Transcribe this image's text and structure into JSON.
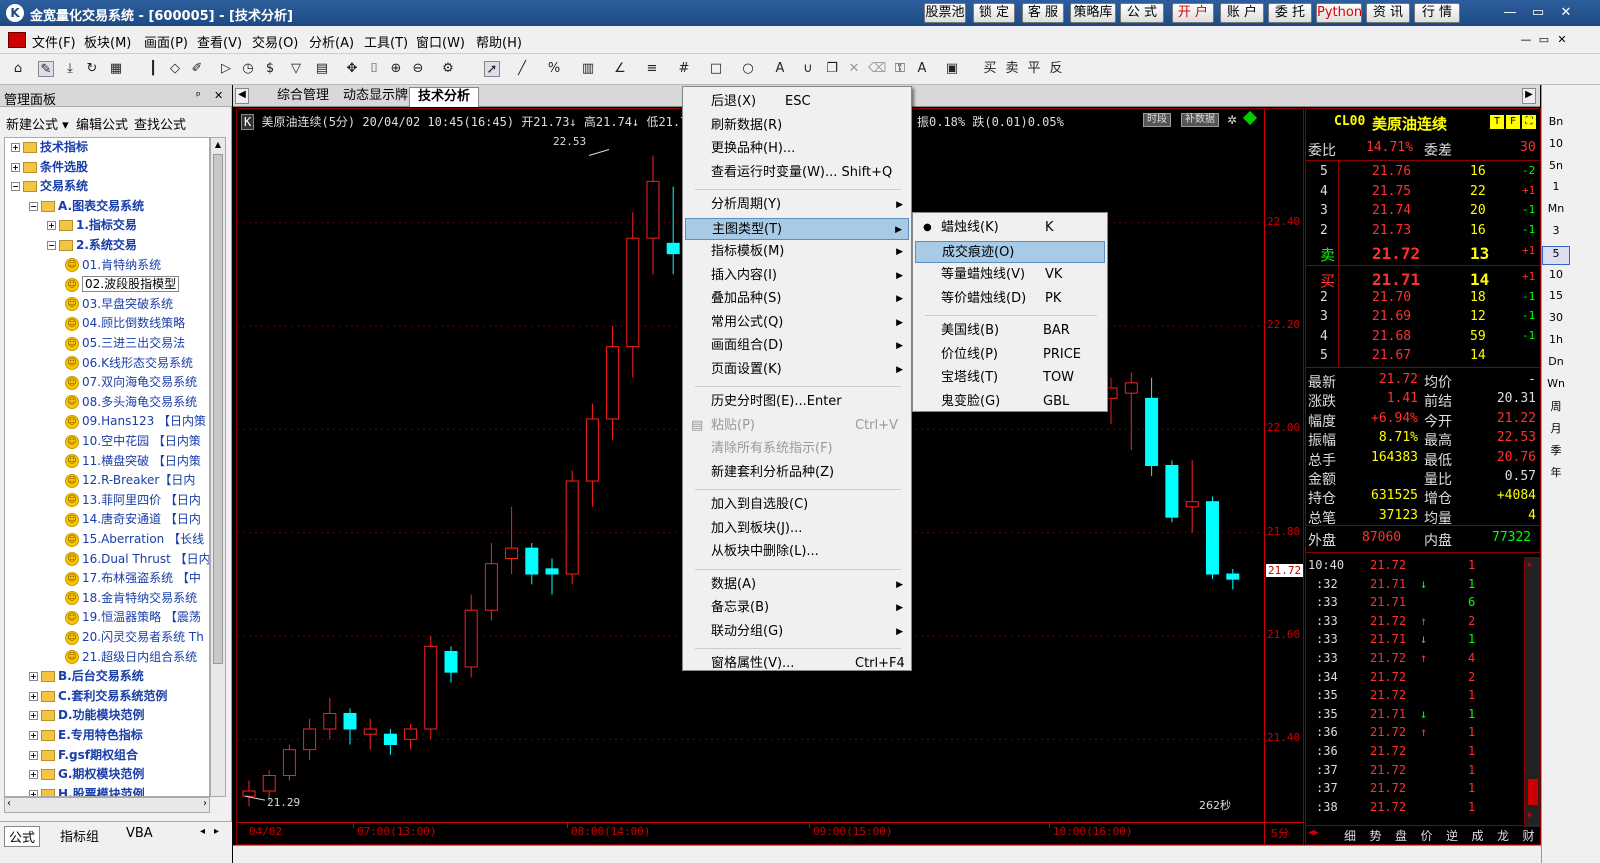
{
  "titlebar": {
    "logo": "K",
    "title": "金宽量化交易系统 - [600005] - [技术分析]",
    "buttons": [
      "股票池",
      "锁 定",
      "客 服",
      "策略库",
      "公 式",
      "开 户",
      "账 户",
      "委 托",
      "Python",
      "资 讯",
      "行 情"
    ],
    "win_controls": [
      "—",
      "▭",
      "✕"
    ]
  },
  "menubar": {
    "items": [
      "文件(F)",
      "板块(M)",
      "画面(P)",
      "查看(V)",
      "交易(O)",
      "分析(A)",
      "工具(T)",
      "窗口(W)",
      "帮助(H)"
    ],
    "win_controls": [
      "—",
      "▭",
      "✕"
    ]
  },
  "left_panel": {
    "title": "管理面板",
    "pin": "ᵖ",
    "close": "✕",
    "tools": [
      "新建公式 ▾",
      "编辑公式",
      "查找公式"
    ],
    "tree": [
      {
        "label": "技术指标",
        "level": 0,
        "type": "folder",
        "exp": "+"
      },
      {
        "label": "条件选股",
        "level": 0,
        "type": "folder",
        "exp": "+"
      },
      {
        "label": "交易系统",
        "level": 0,
        "type": "folder",
        "exp": "−"
      },
      {
        "label": "A.图表交易系统",
        "level": 1,
        "type": "folder",
        "exp": "−"
      },
      {
        "label": "1.指标交易",
        "level": 2,
        "type": "folder",
        "exp": "+"
      },
      {
        "label": "2.系统交易",
        "level": 2,
        "type": "folder",
        "exp": "−"
      },
      {
        "label": "01.肯特纳系统",
        "level": 3,
        "type": "item"
      },
      {
        "label": "02.波段股指模型",
        "level": 3,
        "type": "item",
        "selected": true
      },
      {
        "label": "03.早盘突破系统",
        "level": 3,
        "type": "item"
      },
      {
        "label": "04.顾比倒数线策略",
        "level": 3,
        "type": "item"
      },
      {
        "label": "05.三进三出交易法",
        "level": 3,
        "type": "item"
      },
      {
        "label": "06.K线形态交易系统",
        "level": 3,
        "type": "item"
      },
      {
        "label": "07.双向海龟交易系统",
        "level": 3,
        "type": "item"
      },
      {
        "label": "08.多头海龟交易系统",
        "level": 3,
        "type": "item"
      },
      {
        "label": "09.Hans123 【日内策",
        "level": 3,
        "type": "item"
      },
      {
        "label": "10.空中花园 【日内策",
        "level": 3,
        "type": "item"
      },
      {
        "label": "11.横盘突破 【日内策",
        "level": 3,
        "type": "item"
      },
      {
        "label": "12.R-Breaker【日内",
        "level": 3,
        "type": "item"
      },
      {
        "label": "13.菲阿里四价 【日内",
        "level": 3,
        "type": "item"
      },
      {
        "label": "14.唐奇安通道 【日内",
        "level": 3,
        "type": "item"
      },
      {
        "label": "15.Aberration 【长线",
        "level": 3,
        "type": "item"
      },
      {
        "label": "16.Dual Thrust 【日内",
        "level": 3,
        "type": "item"
      },
      {
        "label": "17.布林强盗系统 【中",
        "level": 3,
        "type": "item"
      },
      {
        "label": "18.金肯特纳交易系统",
        "level": 3,
        "type": "item"
      },
      {
        "label": "19.恒温器策略 【震荡",
        "level": 3,
        "type": "item"
      },
      {
        "label": "20.闪灵交易者系统 Th",
        "level": 3,
        "type": "item"
      },
      {
        "label": "21.超级日内组合系统",
        "level": 3,
        "type": "item"
      },
      {
        "label": "B.后台交易系统",
        "level": 1,
        "type": "folder",
        "exp": "+"
      },
      {
        "label": "C.套利交易系统范例",
        "level": 1,
        "type": "folder",
        "exp": "+"
      },
      {
        "label": "D.功能模块范例",
        "level": 1,
        "type": "folder",
        "exp": "+"
      },
      {
        "label": "E.专用特色指标",
        "level": 1,
        "type": "folder",
        "exp": "+"
      },
      {
        "label": "F.gsf期权组合",
        "level": 1,
        "type": "folder",
        "exp": "+"
      },
      {
        "label": "G.期权模块范例",
        "level": 1,
        "type": "folder",
        "exp": "+"
      },
      {
        "label": "H.股票模块范例",
        "level": 1,
        "type": "folder",
        "exp": "+"
      }
    ],
    "bottom_tabs": [
      "公式",
      "指标组",
      "VBA",
      "◂",
      "▸"
    ]
  },
  "tabs": [
    "综合管理",
    "动态显示牌",
    "技术分析"
  ],
  "chart": {
    "info": "美原油连续(5分) 20/04/02 10:45(16:45) 开21.73↓ 高21.74↓ 低21.70",
    "info_right": "振0.18% 跌(0.01)0.05%",
    "badges": [
      "时段",
      "补数据"
    ],
    "high_label": "22.53",
    "low_label": "21.29",
    "last_price": "21.72",
    "countdown": "262秒",
    "period": "5分",
    "price_ticks": [
      "22.40",
      "22.20",
      "22.00",
      "21.80",
      "21.60",
      "21.40"
    ],
    "x_labels": [
      "04/02",
      "07:00(13:00)",
      "08:00(14:00)",
      "09:00(15:00)",
      "10:00(16:00)"
    ]
  },
  "chart_data": {
    "type": "candlestick",
    "ylim": [
      21.24,
      22.62
    ],
    "candles": [
      {
        "o": 21.3,
        "h": 21.32,
        "l": 21.27,
        "c": 21.29,
        "dir": "up"
      },
      {
        "o": 21.3,
        "h": 21.34,
        "l": 21.28,
        "c": 21.33,
        "dir": "up"
      },
      {
        "o": 21.33,
        "h": 21.39,
        "l": 21.32,
        "c": 21.38,
        "dir": "up"
      },
      {
        "o": 21.38,
        "h": 21.44,
        "l": 21.36,
        "c": 21.42,
        "dir": "up"
      },
      {
        "o": 21.42,
        "h": 21.48,
        "l": 21.4,
        "c": 21.45,
        "dir": "up"
      },
      {
        "o": 21.45,
        "h": 21.46,
        "l": 21.39,
        "c": 21.42,
        "dir": "down"
      },
      {
        "o": 21.42,
        "h": 21.44,
        "l": 21.38,
        "c": 21.41,
        "dir": "up"
      },
      {
        "o": 21.41,
        "h": 21.42,
        "l": 21.37,
        "c": 21.39,
        "dir": "down"
      },
      {
        "o": 21.4,
        "h": 21.43,
        "l": 21.38,
        "c": 21.42,
        "dir": "up"
      },
      {
        "o": 21.42,
        "h": 21.6,
        "l": 21.4,
        "c": 21.58,
        "dir": "up"
      },
      {
        "o": 21.57,
        "h": 21.58,
        "l": 21.51,
        "c": 21.53,
        "dir": "down"
      },
      {
        "o": 21.54,
        "h": 21.68,
        "l": 21.52,
        "c": 21.65,
        "dir": "up"
      },
      {
        "o": 21.65,
        "h": 21.78,
        "l": 21.63,
        "c": 21.74,
        "dir": "up"
      },
      {
        "o": 21.75,
        "h": 21.85,
        "l": 21.72,
        "c": 21.77,
        "dir": "up"
      },
      {
        "o": 21.77,
        "h": 21.78,
        "l": 21.7,
        "c": 21.72,
        "dir": "down"
      },
      {
        "o": 21.73,
        "h": 21.75,
        "l": 21.68,
        "c": 21.72,
        "dir": "down"
      },
      {
        "o": 21.72,
        "h": 21.92,
        "l": 21.7,
        "c": 21.9,
        "dir": "up"
      },
      {
        "o": 21.9,
        "h": 22.05,
        "l": 21.85,
        "c": 22.02,
        "dir": "up"
      },
      {
        "o": 22.02,
        "h": 22.2,
        "l": 21.98,
        "c": 22.16,
        "dir": "up"
      },
      {
        "o": 22.16,
        "h": 22.42,
        "l": 22.1,
        "c": 22.37,
        "dir": "up"
      },
      {
        "o": 22.37,
        "h": 22.53,
        "l": 22.3,
        "c": 22.48,
        "dir": "up"
      },
      {
        "o": 22.36,
        "h": 22.47,
        "l": 22.3,
        "c": 22.34,
        "dir": "down"
      },
      {
        "o": 22.34,
        "h": 22.36,
        "l": 22.0,
        "c": 22.05,
        "dir": "down"
      },
      {
        "o": 22.06,
        "h": 22.1,
        "l": 22.01,
        "c": 22.08,
        "dir": "up"
      },
      {
        "o": 22.09,
        "h": 22.11,
        "l": 21.96,
        "c": 22.07,
        "dir": "up"
      },
      {
        "o": 22.06,
        "h": 22.1,
        "l": 21.91,
        "c": 21.93,
        "dir": "down"
      },
      {
        "o": 21.93,
        "h": 21.94,
        "l": 21.82,
        "c": 21.83,
        "dir": "down"
      },
      {
        "o": 21.85,
        "h": 21.94,
        "l": 21.8,
        "c": 21.86,
        "dir": "up"
      },
      {
        "o": 21.86,
        "h": 21.87,
        "l": 21.71,
        "c": 21.72,
        "dir": "down"
      },
      {
        "o": 21.72,
        "h": 21.73,
        "l": 21.69,
        "c": 21.71,
        "dir": "down"
      }
    ]
  },
  "quote": {
    "code": "CL00",
    "name": "美原油连续",
    "wei_bi_label": "委比",
    "wei_bi": "14.71%",
    "wei_cha_label": "委差",
    "wei_cha": "30",
    "sells": [
      {
        "lv": "5",
        "price": "21.76",
        "vol": "16",
        "chg": "-2"
      },
      {
        "lv": "4",
        "price": "21.75",
        "vol": "22",
        "chg": "+1"
      },
      {
        "lv": "3",
        "price": "21.74",
        "vol": "20",
        "chg": "-1"
      },
      {
        "lv": "2",
        "price": "21.73",
        "vol": "16",
        "chg": "-1"
      },
      {
        "lv": "卖",
        "price": "21.72",
        "vol": "13",
        "chg": "+1"
      }
    ],
    "buys": [
      {
        "lv": "买",
        "price": "21.71",
        "vol": "14",
        "chg": "+1"
      },
      {
        "lv": "2",
        "price": "21.70",
        "vol": "18",
        "chg": "-1"
      },
      {
        "lv": "3",
        "price": "21.69",
        "vol": "12",
        "chg": "-1"
      },
      {
        "lv": "4",
        "price": "21.68",
        "vol": "59",
        "chg": "-1"
      },
      {
        "lv": "5",
        "price": "21.67",
        "vol": "14",
        "chg": ""
      }
    ],
    "stats": [
      [
        "最新",
        "21.72",
        "均价",
        "-"
      ],
      [
        "涨跌",
        "1.41",
        "前结",
        "20.31"
      ],
      [
        "幅度",
        "+6.94%",
        "今开",
        "21.22"
      ],
      [
        "振幅",
        "8.71%",
        "最高",
        "22.53"
      ],
      [
        "总手",
        "164383",
        "最低",
        "20.76"
      ],
      [
        "金额",
        "",
        "量比",
        "0.57"
      ],
      [
        "持仓",
        "631525",
        "增仓",
        "+4084"
      ],
      [
        "总笔",
        "37123",
        "均量",
        "4"
      ]
    ],
    "outer_label": "外盘",
    "outer": "87060",
    "inner_label": "内盘",
    "inner": "77322",
    "ticks": [
      {
        "t": "10:40",
        "p": "21.72",
        "a": "",
        "v": "1"
      },
      {
        "t": ":32",
        "p": "21.71",
        "a": "↓",
        "v": "1"
      },
      {
        "t": ":33",
        "p": "21.71",
        "a": "",
        "v": "6"
      },
      {
        "t": ":33",
        "p": "21.72",
        "a": "↑",
        "v": "2"
      },
      {
        "t": ":33",
        "p": "21.71",
        "a": "↓",
        "v": "1"
      },
      {
        "t": ":33",
        "p": "21.72",
        "a": "↑",
        "v": "4"
      },
      {
        "t": ":34",
        "p": "21.72",
        "a": "",
        "v": "2"
      },
      {
        "t": ":35",
        "p": "21.72",
        "a": "",
        "v": "1"
      },
      {
        "t": ":35",
        "p": "21.71",
        "a": "↓",
        "v": "1"
      },
      {
        "t": ":36",
        "p": "21.72",
        "a": "↑",
        "v": "1"
      },
      {
        "t": ":36",
        "p": "21.72",
        "a": "",
        "v": "1"
      },
      {
        "t": ":37",
        "p": "21.72",
        "a": "",
        "v": "1"
      },
      {
        "t": ":37",
        "p": "21.72",
        "a": "",
        "v": "1"
      },
      {
        "t": ":38",
        "p": "21.72",
        "a": "",
        "v": "1"
      }
    ],
    "bottom_tabs": [
      "细",
      "势",
      "盘",
      "价",
      "逆",
      "成",
      "龙",
      "财"
    ]
  },
  "right_bar": [
    "Bn",
    "10",
    "5n",
    "1",
    "Mn",
    "3",
    "5",
    "10",
    "15",
    "30",
    "1h",
    "Dn",
    "Wn",
    "周",
    "月",
    "季",
    "年"
  ],
  "context_menu": {
    "items": [
      {
        "label": "后退(X)",
        "sc": "ESC"
      },
      {
        "label": "刷新数据(R)",
        "sc": ""
      },
      {
        "label": "更换品种(H)...",
        "sc": ""
      },
      {
        "label": "查看运行时变量(W)... Shift+Q",
        "sc": ""
      },
      {
        "sep": true
      },
      {
        "label": "分析周期(Y)",
        "arr": true
      },
      {
        "label": "主图类型(T)",
        "arr": true,
        "hl": true
      },
      {
        "label": "指标模板(M)",
        "arr": true
      },
      {
        "label": "插入内容(I)",
        "arr": true
      },
      {
        "label": "叠加品种(S)",
        "arr": true
      },
      {
        "label": "常用公式(Q)",
        "arr": true
      },
      {
        "label": "画面组合(D)",
        "arr": true
      },
      {
        "label": "页面设置(K)",
        "arr": true
      },
      {
        "sep": true
      },
      {
        "label": "历史分时图(E)...Enter",
        "sc": ""
      },
      {
        "label": "粘贴(P)",
        "sc": "Ctrl+V",
        "dis": true
      },
      {
        "label": "清除所有系统指示(F)",
        "sc": "",
        "dis": true
      },
      {
        "label": "新建套利分析品种(Z)",
        "sc": ""
      },
      {
        "sep": true
      },
      {
        "label": "加入到自选股(C)",
        "sc": ""
      },
      {
        "label": "加入到板块(J)...",
        "sc": ""
      },
      {
        "label": "从板块中删除(L)...",
        "sc": ""
      },
      {
        "sep": true
      },
      {
        "label": "数据(A)",
        "arr": true
      },
      {
        "label": "备忘录(B)",
        "arr": true
      },
      {
        "label": "联动分组(G)",
        "arr": true
      },
      {
        "sep": true
      },
      {
        "label": "窗格属性(V)...",
        "sc": "Ctrl+F4"
      }
    ]
  },
  "submenu": {
    "items": [
      {
        "label": "蜡烛线(K)",
        "sc": "K",
        "bullet": "●"
      },
      {
        "label": "成交痕迹(O)",
        "sc": "",
        "hl": true
      },
      {
        "label": "等量蜡烛线(V)",
        "sc": "VK"
      },
      {
        "label": "等价蜡烛线(D)",
        "sc": "PK"
      },
      {
        "sep": true
      },
      {
        "label": "美国线(B)",
        "sc": "BAR"
      },
      {
        "label": "价位线(P)",
        "sc": "PRICE"
      },
      {
        "label": "宝塔线(T)",
        "sc": "TOW"
      },
      {
        "label": "鬼变脸(G)",
        "sc": "GBL"
      }
    ]
  },
  "colors": {
    "up": "#ff2020",
    "down": "#00ffff",
    "axis": "#cc0000",
    "yellow": "#ffff00",
    "green": "#00ff00"
  }
}
